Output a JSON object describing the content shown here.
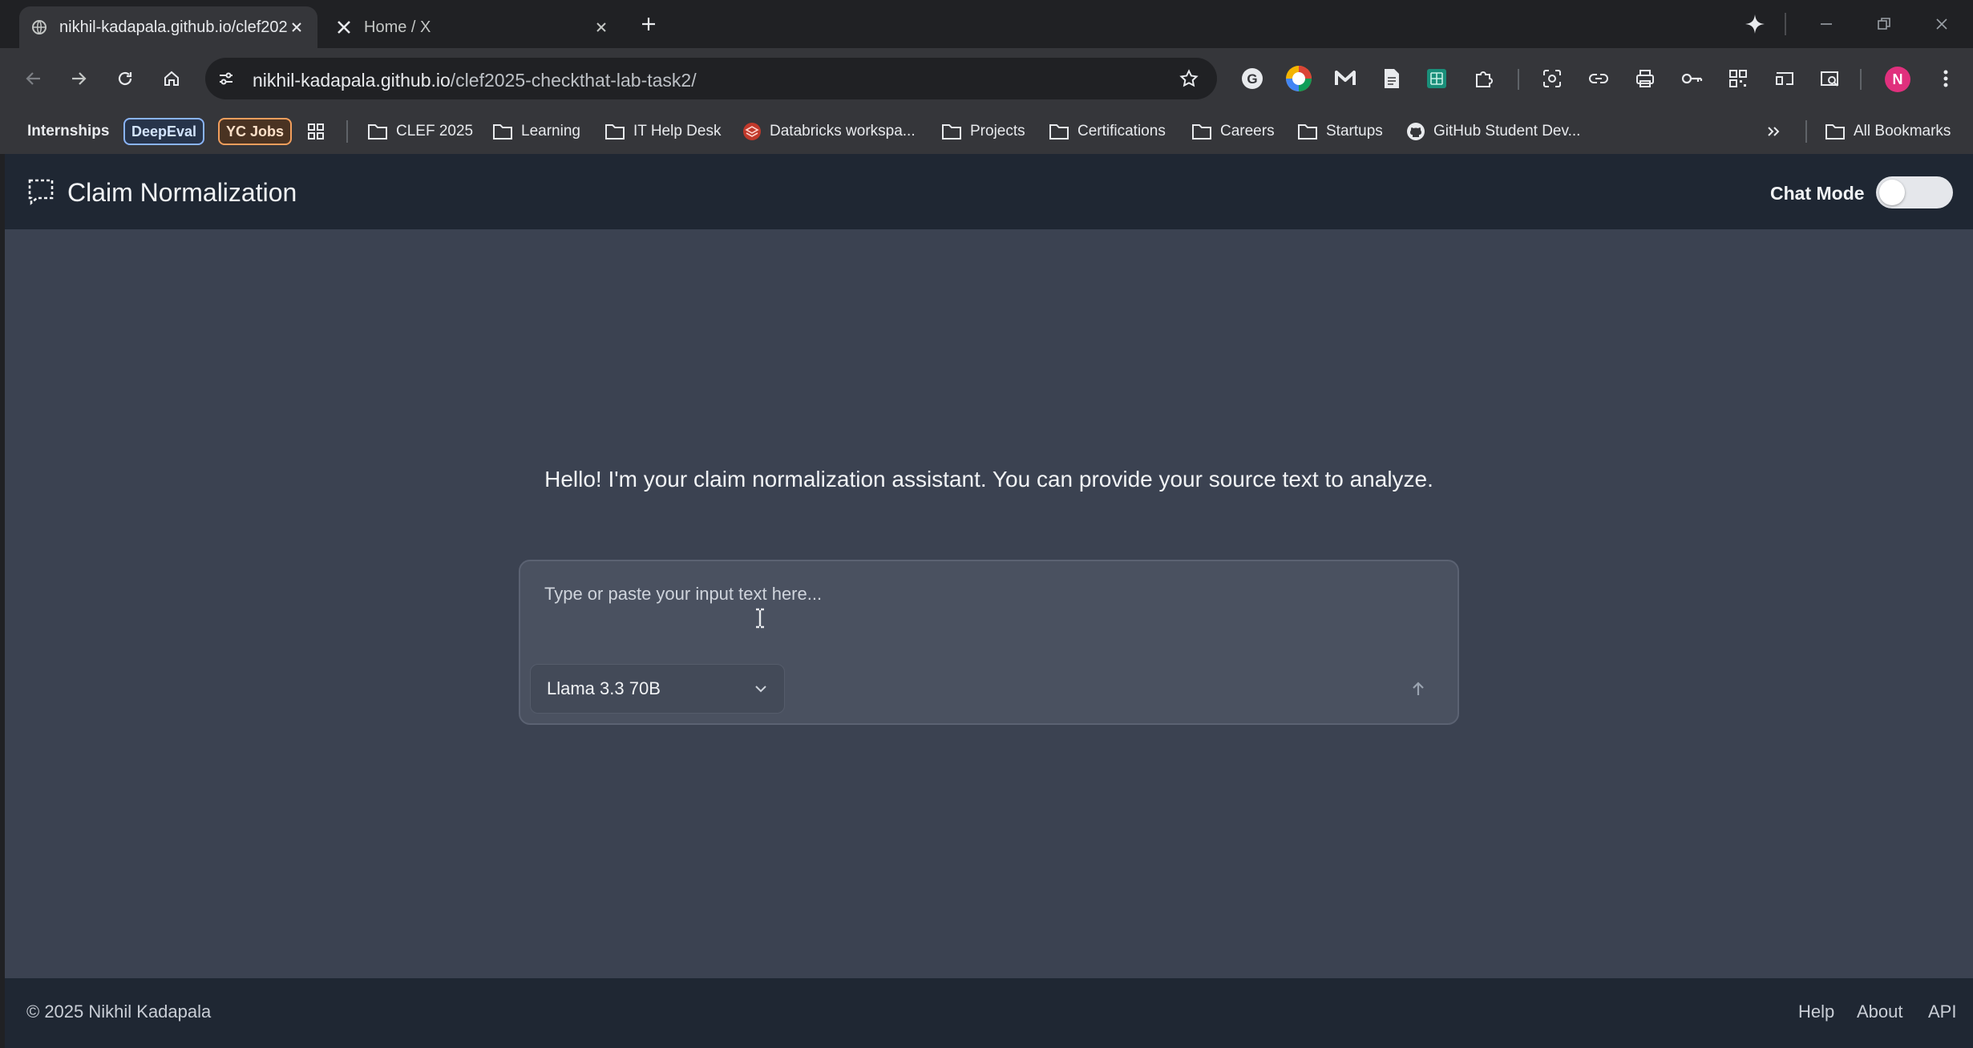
{
  "browser": {
    "tabs": [
      {
        "title": "nikhil-kadapala.github.io/clef2025-checkthat-lab-task2/",
        "active": true
      },
      {
        "title": "Home / X",
        "active": false
      }
    ],
    "url_host": "nikhil-kadapala.github.io",
    "url_path": "/clef2025-checkthat-lab-task2/",
    "profile_initial": "N"
  },
  "bookmarks": {
    "items": [
      {
        "label": "Internships",
        "type": "text"
      },
      {
        "label": "DeepEval",
        "type": "chip"
      },
      {
        "label": "YC Jobs",
        "type": "chip"
      },
      {
        "label": "CLEF 2025",
        "type": "folder"
      },
      {
        "label": "Learning",
        "type": "folder"
      },
      {
        "label": "IT Help Desk",
        "type": "folder"
      },
      {
        "label": "Databricks workspa...",
        "type": "link"
      },
      {
        "label": "Projects",
        "type": "folder"
      },
      {
        "label": "Certifications",
        "type": "folder"
      },
      {
        "label": "Careers",
        "type": "folder"
      },
      {
        "label": "Startups",
        "type": "folder"
      },
      {
        "label": "GitHub Student Dev...",
        "type": "link"
      }
    ],
    "all_bookmarks": "All Bookmarks"
  },
  "app": {
    "title": "Claim Normalization",
    "chat_mode_label": "Chat Mode",
    "chat_mode_on": false,
    "greeting": "Hello! I'm your claim normalization assistant. You can provide your source text to analyze.",
    "input_placeholder": "Type or paste your input text here...",
    "model_selected": "Llama 3.3 70B"
  },
  "footer": {
    "copyright": "© 2025 Nikhil Kadapala",
    "links": [
      "Help",
      "About",
      "API"
    ]
  },
  "colors": {
    "header_bg": "#1f2733",
    "main_bg": "#3b4251",
    "input_bg": "#4a5160",
    "chrome_bg": "#35363a"
  }
}
